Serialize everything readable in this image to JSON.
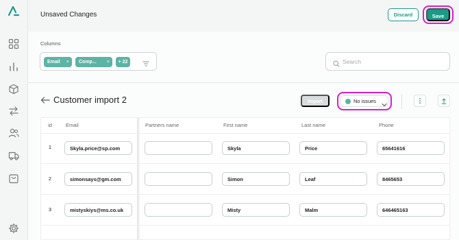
{
  "header": {
    "title": "Unsaved Changes",
    "discard_label": "Discard",
    "save_label": "Save"
  },
  "sidebar": {
    "items": [
      {
        "icon": "logo-icon"
      },
      {
        "icon": "dashboard-icon"
      },
      {
        "icon": "bar-chart-icon"
      },
      {
        "icon": "box-icon"
      },
      {
        "icon": "transfer-icon"
      },
      {
        "icon": "users-icon"
      },
      {
        "icon": "truck-icon"
      },
      {
        "icon": "shopping-bag-icon"
      },
      {
        "icon": "gear-icon"
      }
    ]
  },
  "columns_filter": {
    "label": "Columns",
    "chips": [
      "Email",
      "Comp..."
    ],
    "more_label": "+ 22"
  },
  "search": {
    "placeholder": "Search",
    "value": ""
  },
  "import_page": {
    "title": "Customer import 2",
    "import_label": "Import",
    "status_label": "No issues",
    "status_color": "#5db3a4"
  },
  "table": {
    "headers": [
      "id",
      "Email",
      "Partners name",
      "First name",
      "Last name",
      "Phone"
    ],
    "rows": [
      {
        "id": "1",
        "email": "Skyla.price@sp.com",
        "partners_name": "",
        "first_name": "Skyla",
        "last_name": "Price",
        "phone": "65641616"
      },
      {
        "id": "2",
        "email": "simonsays@gm.com",
        "partners_name": "",
        "first_name": "Simon",
        "last_name": "Leaf",
        "phone": "8465653"
      },
      {
        "id": "3",
        "email": "mistyskiys@ms.co.uk",
        "partners_name": "",
        "first_name": "Misty",
        "last_name": "Malm",
        "phone": "646465163"
      }
    ]
  },
  "colors": {
    "accent": "#1b9a8a",
    "chip": "#5db3a4",
    "highlight_ring": "#d81bd8"
  }
}
